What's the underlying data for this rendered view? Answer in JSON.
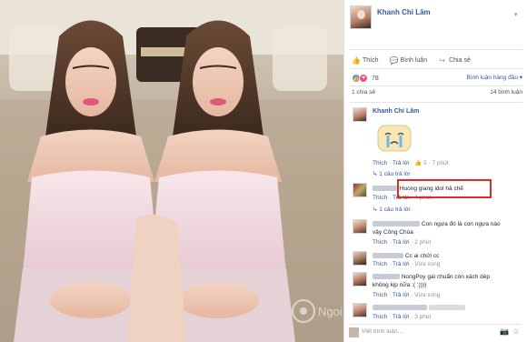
{
  "post": {
    "author": "Khanh Chi Lâm",
    "actions": {
      "like": "Thích",
      "comment": "Bình luận",
      "share": "Chia sẻ"
    },
    "reaction_count": "78",
    "sort_label": "Bình luận hàng đầu ▾",
    "share_count": "1 chia sẻ",
    "comment_count": "14 bình luận"
  },
  "comments": {
    "c1": {
      "author": "Khanh Chi Lâm",
      "like": "Thích",
      "reply": "Trả lời",
      "likes": "5",
      "time": "7 phút",
      "replies": "1 câu trả lời"
    },
    "c2": {
      "text": "Huong giang idol hả chế",
      "like": "Thích",
      "reply": "Trả lời",
      "time": "4 phút",
      "replies": "1 câu trả lời"
    },
    "c3": {
      "text_line1": "Con ngựa đó là con ngựa nào",
      "text_line2": "vậy Công Chúa",
      "like": "Thích",
      "reply": "Trả lời",
      "time": "2 phút"
    },
    "c4": {
      "text": "Cc ai chửi cc",
      "like": "Thích",
      "reply": "Trả lời",
      "time": "Vừa xong"
    },
    "c5": {
      "text_line1": "NongPoy gái chuẩn còn xách dép",
      "text_line2": "không kịp nữa :( :))))",
      "like": "Thích",
      "reply": "Trả lời",
      "time": "Vừa xong"
    },
    "c6": {
      "like": "Thích",
      "reply": "Trả lời",
      "time": "3 phút"
    }
  },
  "composer": {
    "placeholder": "Viết bình luận..."
  },
  "watermark": {
    "text": "NgoiSao.vn"
  },
  "icons": {
    "like": "thumbs-up-icon",
    "comment": "comment-bubble-icon",
    "share": "share-arrow-icon",
    "camera": "camera-icon",
    "emoji": "emoji-icon"
  },
  "colors": {
    "link": "#365899",
    "highlight": "#e02b2b",
    "like": "#5890ff",
    "love": "#f25268"
  }
}
